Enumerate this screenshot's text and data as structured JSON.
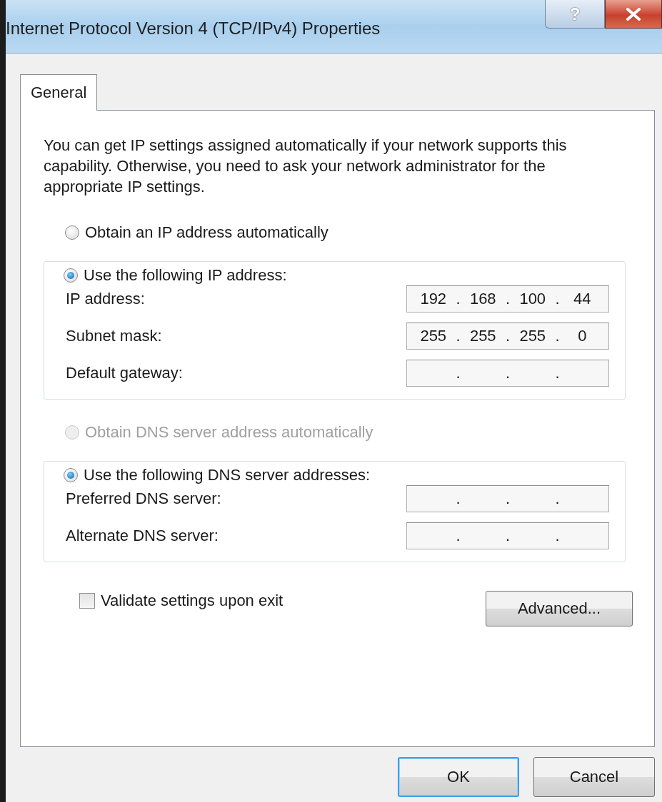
{
  "window": {
    "title": "Internet Protocol Version 4 (TCP/IPv4) Properties",
    "help_button": "?"
  },
  "tabs": [
    {
      "label": "General",
      "selected": true
    }
  ],
  "description": "You can get IP settings assigned automatically if your network supports this capability. Otherwise, you need to ask your network administrator for the appropriate IP settings.",
  "ip_section": {
    "auto_option": {
      "label": "Obtain an IP address automatically",
      "selected": false,
      "disabled": false
    },
    "manual_option": {
      "label": "Use the following IP address:",
      "selected": true,
      "disabled": false
    },
    "fields": [
      {
        "label": "IP address:",
        "octets": [
          "192",
          "168",
          "100",
          "44"
        ],
        "dots": [
          ".",
          ".",
          "."
        ]
      },
      {
        "label": "Subnet mask:",
        "octets": [
          "255",
          "255",
          "255",
          "0"
        ],
        "dots": [
          ".",
          ".",
          "."
        ]
      },
      {
        "label": "Default gateway:",
        "dots": [
          ".",
          ".",
          "."
        ]
      }
    ]
  },
  "dns_section": {
    "auto_option": {
      "label": "Obtain DNS server address automatically",
      "selected": false,
      "disabled": true
    },
    "manual_option": {
      "label": "Use the following DNS server addresses:",
      "selected": true,
      "disabled": false
    },
    "fields": [
      {
        "label": "Preferred DNS server:",
        "dots": [
          ".",
          ".",
          "."
        ]
      },
      {
        "label": "Alternate DNS server:",
        "dots": [
          ".",
          ".",
          "."
        ]
      }
    ]
  },
  "validate_checkbox": {
    "label": "Validate settings upon exit",
    "checked": false
  },
  "advanced_button": "Advanced...",
  "buttons": [
    {
      "label": "OK",
      "default": true
    },
    {
      "label": "Cancel",
      "default": false
    }
  ]
}
